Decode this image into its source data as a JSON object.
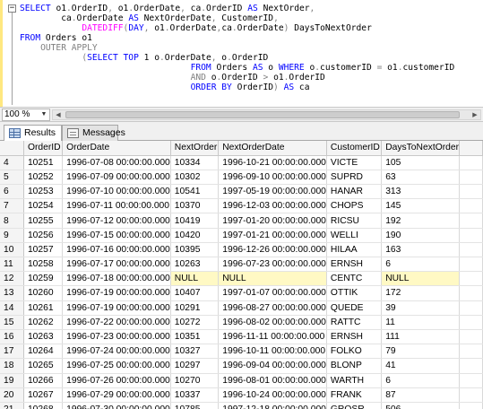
{
  "editor": {
    "collapse_symbol": "−",
    "lines": [
      [
        [
          "kw",
          "SELECT "
        ],
        [
          "",
          "o1"
        ],
        [
          "gr",
          "."
        ],
        [
          "",
          "OrderID"
        ],
        [
          "gr",
          ", "
        ],
        [
          "",
          "o1"
        ],
        [
          "gr",
          "."
        ],
        [
          "",
          "OrderDate"
        ],
        [
          "gr",
          ", "
        ],
        [
          "",
          "ca"
        ],
        [
          "gr",
          "."
        ],
        [
          "",
          "OrderID "
        ],
        [
          "kw",
          "AS "
        ],
        [
          "",
          "NextOrder"
        ],
        [
          "gr",
          ","
        ]
      ],
      [
        [
          "",
          "        ca"
        ],
        [
          "gr",
          "."
        ],
        [
          "",
          "OrderDate "
        ],
        [
          "kw",
          "AS "
        ],
        [
          "",
          "NextOrderDate"
        ],
        [
          "gr",
          ", "
        ],
        [
          "",
          "CustomerID"
        ],
        [
          "gr",
          ","
        ]
      ],
      [
        [
          "",
          "            "
        ],
        [
          "fn",
          "DATEDIFF"
        ],
        [
          "gr",
          "("
        ],
        [
          "kw",
          "DAY"
        ],
        [
          "gr",
          ", "
        ],
        [
          "",
          "o1"
        ],
        [
          "gr",
          "."
        ],
        [
          "",
          "OrderDate"
        ],
        [
          "gr",
          ","
        ],
        [
          "",
          "ca"
        ],
        [
          "gr",
          "."
        ],
        [
          "",
          "OrderDate"
        ],
        [
          "gr",
          ") "
        ],
        [
          "",
          "DaysToNextOrder"
        ]
      ],
      [
        [
          "kw",
          "FROM "
        ],
        [
          "",
          "Orders o1"
        ]
      ],
      [
        [
          "",
          "    "
        ],
        [
          "gr",
          "OUTER APPLY"
        ]
      ],
      [
        [
          "",
          "            "
        ],
        [
          "gr",
          "("
        ],
        [
          "kw",
          "SELECT TOP "
        ],
        [
          "",
          "1 o"
        ],
        [
          "gr",
          "."
        ],
        [
          "",
          "OrderDate"
        ],
        [
          "gr",
          ", "
        ],
        [
          "",
          "o"
        ],
        [
          "gr",
          "."
        ],
        [
          "",
          "OrderID"
        ]
      ],
      [
        [
          "",
          "                                 "
        ],
        [
          "kw",
          "FROM "
        ],
        [
          "",
          "Orders "
        ],
        [
          "kw",
          "AS "
        ],
        [
          "",
          "o "
        ],
        [
          "kw",
          "WHERE "
        ],
        [
          "",
          "o"
        ],
        [
          "gr",
          "."
        ],
        [
          "",
          "customerID "
        ],
        [
          "gr",
          "= "
        ],
        [
          "",
          "o1"
        ],
        [
          "gr",
          "."
        ],
        [
          "",
          "customerID"
        ]
      ],
      [
        [
          "",
          "                                 "
        ],
        [
          "gr",
          "AND "
        ],
        [
          "",
          "o"
        ],
        [
          "gr",
          "."
        ],
        [
          "",
          "OrderID "
        ],
        [
          "gr",
          "> "
        ],
        [
          "",
          "o1"
        ],
        [
          "gr",
          "."
        ],
        [
          "",
          "OrderID"
        ]
      ],
      [
        [
          "",
          "                                 "
        ],
        [
          "kw",
          "ORDER BY "
        ],
        [
          "",
          "OrderID"
        ],
        [
          "gr",
          ") "
        ],
        [
          "kw",
          "AS "
        ],
        [
          "",
          "ca"
        ]
      ]
    ]
  },
  "zoom": {
    "value": "100 %",
    "dropdown_icon": "chevron-down-icon"
  },
  "tabs": [
    {
      "label": "Results",
      "icon": "grid-icon",
      "active": true
    },
    {
      "label": "Messages",
      "icon": "messages-icon",
      "active": false
    }
  ],
  "grid": {
    "columns": [
      "",
      "OrderID",
      "OrderDate",
      "NextOrder",
      "NextOrderDate",
      "CustomerID",
      "DaysToNextOrder"
    ],
    "rows": [
      [
        "4",
        "10251",
        "1996-07-08 00:00:00.000",
        "10334",
        "1996-10-21 00:00:00.000",
        "VICTE",
        "105"
      ],
      [
        "5",
        "10252",
        "1996-07-09 00:00:00.000",
        "10302",
        "1996-09-10 00:00:00.000",
        "SUPRD",
        "63"
      ],
      [
        "6",
        "10253",
        "1996-07-10 00:00:00.000",
        "10541",
        "1997-05-19 00:00:00.000",
        "HANAR",
        "313"
      ],
      [
        "7",
        "10254",
        "1996-07-11 00:00:00.000",
        "10370",
        "1996-12-03 00:00:00.000",
        "CHOPS",
        "145"
      ],
      [
        "8",
        "10255",
        "1996-07-12 00:00:00.000",
        "10419",
        "1997-01-20 00:00:00.000",
        "RICSU",
        "192"
      ],
      [
        "9",
        "10256",
        "1996-07-15 00:00:00.000",
        "10420",
        "1997-01-21 00:00:00.000",
        "WELLI",
        "190"
      ],
      [
        "10",
        "10257",
        "1996-07-16 00:00:00.000",
        "10395",
        "1996-12-26 00:00:00.000",
        "HILAA",
        "163"
      ],
      [
        "11",
        "10258",
        "1996-07-17 00:00:00.000",
        "10263",
        "1996-07-23 00:00:00.000",
        "ERNSH",
        "6"
      ],
      [
        "12",
        "10259",
        "1996-07-18 00:00:00.000",
        "NULL",
        "NULL",
        "CENTC",
        "NULL"
      ],
      [
        "13",
        "10260",
        "1996-07-19 00:00:00.000",
        "10407",
        "1997-01-07 00:00:00.000",
        "OTTIK",
        "172"
      ],
      [
        "14",
        "10261",
        "1996-07-19 00:00:00.000",
        "10291",
        "1996-08-27 00:00:00.000",
        "QUEDE",
        "39"
      ],
      [
        "15",
        "10262",
        "1996-07-22 00:00:00.000",
        "10272",
        "1996-08-02 00:00:00.000",
        "RATTC",
        "11"
      ],
      [
        "16",
        "10263",
        "1996-07-23 00:00:00.000",
        "10351",
        "1996-11-11 00:00:00.000",
        "ERNSH",
        "111"
      ],
      [
        "17",
        "10264",
        "1996-07-24 00:00:00.000",
        "10327",
        "1996-10-11 00:00:00.000",
        "FOLKO",
        "79"
      ],
      [
        "18",
        "10265",
        "1996-07-25 00:00:00.000",
        "10297",
        "1996-09-04 00:00:00.000",
        "BLONP",
        "41"
      ],
      [
        "19",
        "10266",
        "1996-07-26 00:00:00.000",
        "10270",
        "1996-08-01 00:00:00.000",
        "WARTH",
        "6"
      ],
      [
        "20",
        "10267",
        "1996-07-29 00:00:00.000",
        "10337",
        "1996-10-24 00:00:00.000",
        "FRANK",
        "87"
      ],
      [
        "21",
        "10268",
        "1996-07-30 00:00:00.000",
        "10785",
        "1997-12-18 00:00:00.000",
        "GROSR",
        "506"
      ]
    ],
    "null_highlight_color": "#fff9c4"
  }
}
